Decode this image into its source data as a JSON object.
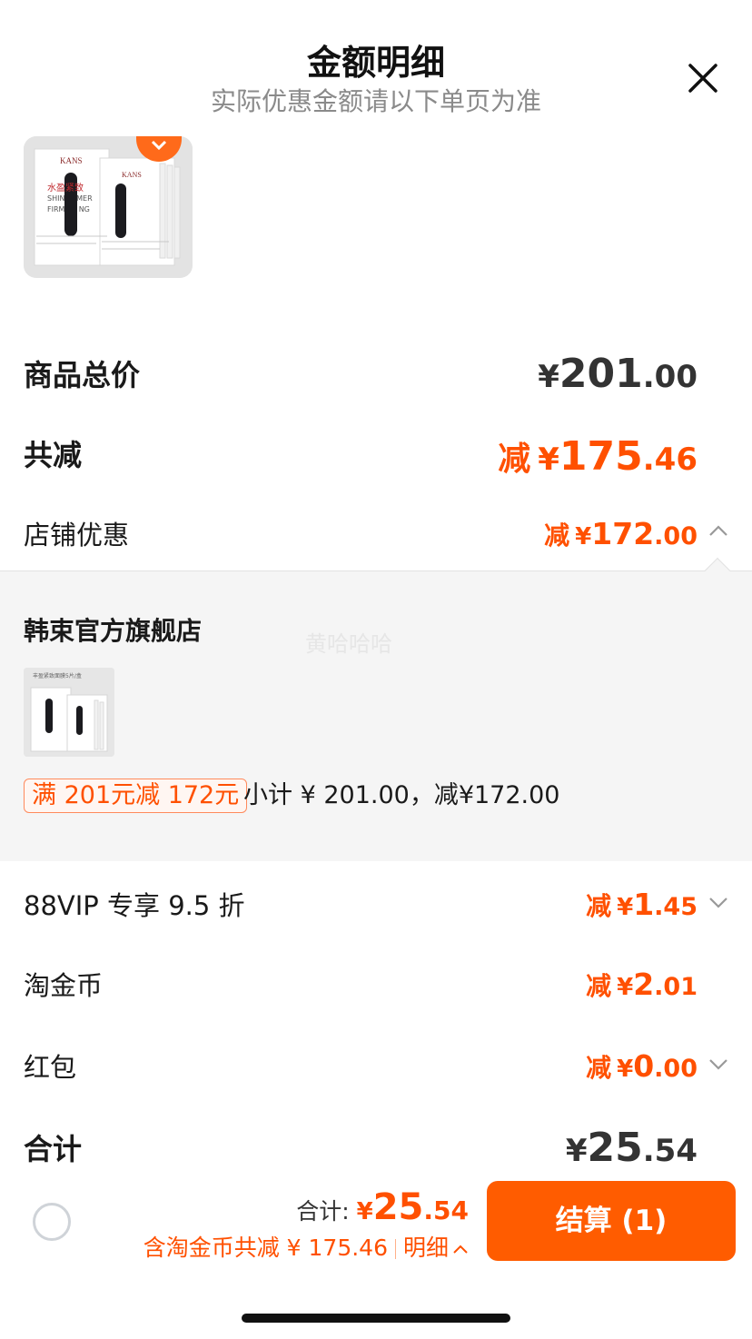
{
  "header": {
    "title": "金额明细",
    "subtitle": "实际优惠金额请以下单页为准"
  },
  "product_image": {
    "brand_text": "KANS",
    "label_text": "水盈紧致",
    "text_line1": "SHIN",
    "text_line1b": "MER",
    "text_line2": "FIRM",
    "text_line2b": "NG"
  },
  "summary": {
    "goods_total": {
      "label": "商品总价",
      "yen": "¥",
      "int": "201",
      "dec": ".00"
    },
    "total_discount": {
      "label": "共减",
      "prefix": "减",
      "yen": "¥",
      "int": "175",
      "dec": ".46"
    },
    "shop_discount": {
      "label": "店铺优惠",
      "prefix": "减",
      "yen": "¥",
      "int": "172",
      "dec": ".00"
    }
  },
  "shop": {
    "name": "韩束官方旗舰店",
    "watermark": "黄哈哈哈",
    "thumb_caption": "丰盈紧致面膜5片/盒",
    "promo_tag": "满 201元减 172元",
    "subtotal": "小计 ¥ 201.00，减¥172.00"
  },
  "discounts": [
    {
      "label": "88VIP 专享 9.5 折",
      "prefix": "减",
      "yen": "¥",
      "int": "1",
      "dec": ".45"
    },
    {
      "label": "淘金币",
      "prefix": "减",
      "yen": "¥",
      "int": "2",
      "dec": ".01"
    },
    {
      "label": "红包",
      "prefix": "减",
      "yen": "¥",
      "int": "0",
      "dec": ".00"
    }
  ],
  "grand_total": {
    "label": "合计",
    "yen": "¥",
    "int": "25",
    "dec": ".54"
  },
  "bottom_bar": {
    "total_label": "合计:",
    "total_yen": "¥",
    "total_int": "25",
    "total_dec": ".54",
    "discount_text": "含淘金币共减 ¥ 175.46",
    "detail_label": "明细",
    "checkout_label": "结算 (1)"
  },
  "colors": {
    "accent": "#ff5000",
    "checkout_bg": "#ff5c00",
    "panel_bg": "#f5f5f5"
  },
  "icons": [
    "close-icon",
    "chevron-up-icon",
    "chevron-down-icon",
    "radio-unchecked-icon",
    "heart-badge-icon"
  ]
}
